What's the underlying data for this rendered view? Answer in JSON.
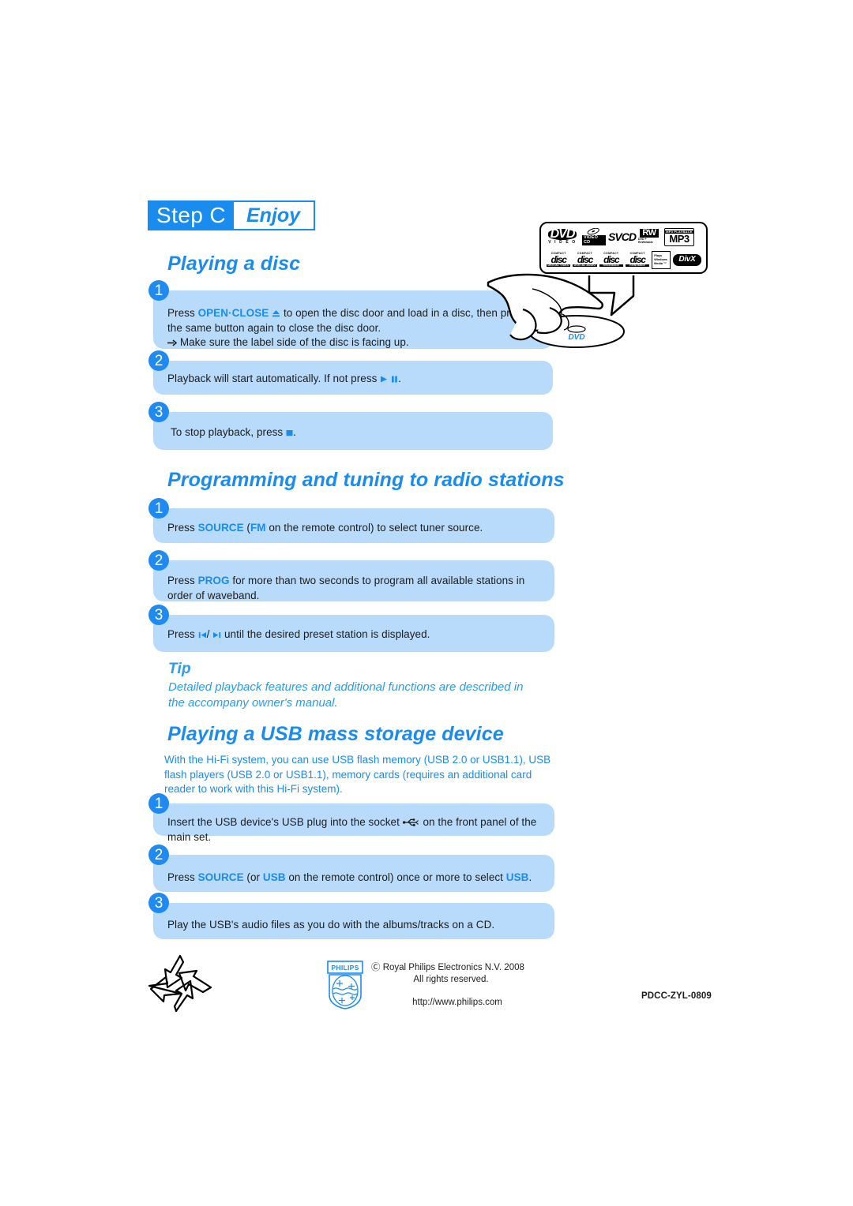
{
  "banner": {
    "step_label": "Step C",
    "step_name": "Enjoy"
  },
  "sections": {
    "disc": {
      "title": "Playing a disc",
      "steps": [
        {
          "number": "1",
          "line1_pre": "Press ",
          "line1_kw": "OPEN·CLOSE",
          "line1_post": " to open the disc door and load in a disc, then press the same button again to close the disc door.",
          "line2": "Make sure the label side of the disc is facing up."
        },
        {
          "number": "2",
          "text_pre": "Playback will start automatically. If not press ",
          "text_post": "."
        },
        {
          "number": "3",
          "text_pre": "To stop playback, press ",
          "text_post": "."
        }
      ]
    },
    "radio": {
      "title": "Programming and tuning to radio stations",
      "steps": [
        {
          "number": "1",
          "pre": "Press ",
          "kw1": "SOURCE",
          "mid": " (",
          "kw2": "FM",
          "post": " on the remote control) to select tuner source."
        },
        {
          "number": "2",
          "pre": "Press ",
          "kw1": "PROG",
          "post": " for more than two seconds to program all available stations in order of waveband."
        },
        {
          "number": "3",
          "pre": "Press ",
          "post": " until the desired preset station is displayed."
        }
      ]
    },
    "tip": {
      "head": "Tip",
      "body": "Detailed playback features and additional functions are described in the accompany owner's manual."
    },
    "usb": {
      "title": "Playing a USB mass storage device",
      "intro": " With the Hi-Fi system, you can use USB flash memory (USB 2.0 or USB1.1), USB flash players (USB 2.0 or USB1.1), memory cards (requires an additional card reader  to work with this Hi-Fi system).",
      "steps": [
        {
          "number": "1",
          "pre": "Insert the USB device's USB plug into the socket ",
          "post": " on the front panel of the main set."
        },
        {
          "number": "2",
          "pre": "Press ",
          "kw1": "SOURCE",
          "mid": " (or ",
          "kw2": "USB",
          "mid2": " on the remote control) once or more to select ",
          "kw3": "USB",
          "post": "."
        },
        {
          "number": "3",
          "text": "Play the USB's audio files as you do with the albums/tracks on a CD."
        }
      ]
    }
  },
  "callout": {
    "logos": [
      "DVD VIDEO",
      "VIDEO CD",
      "SVCD",
      "RW ReWritable",
      "MP3 PLAYBACK",
      "COMPACT disc DIGITAL VIDEO",
      "COMPACT disc DIGITAL AUDIO",
      "COMPACT disc Recordable",
      "COMPACT disc ReWritable",
      "Plays Windows Media",
      "DivX"
    ],
    "dvd_main": "DVD",
    "dvd_sub": "V I D E O",
    "vcd_label": "VIDEO CD",
    "svcd_label": "SVCD",
    "rw_main": "RW",
    "rw_sub": "DVD + ReWritable",
    "mp3_top": "MP3 PLAYBACK",
    "mp3_main": "MP3",
    "disc1_top": "COMPACT",
    "disc_word": "disc",
    "disc1_bottom": "DIGITAL VIDEO",
    "disc2_bottom": "DIGITAL AUDIO",
    "disc3_bottom": "Recordable",
    "disc4_bottom": "ReWritable",
    "wma_l1": "Plays",
    "wma_l2": "Windows",
    "wma_l3": "Media ™",
    "divx_label": "DivX"
  },
  "disc_art": {
    "disc_label": "DVD"
  },
  "footer": {
    "philips_wordmark": "PHILIPS",
    "copyright": "Ⓒ Royal Philips Electronics N.V. 2008",
    "rights": "All rights reserved.",
    "url": "http://www.philips.com",
    "doc_code": "PDCC-ZYL-0809"
  }
}
